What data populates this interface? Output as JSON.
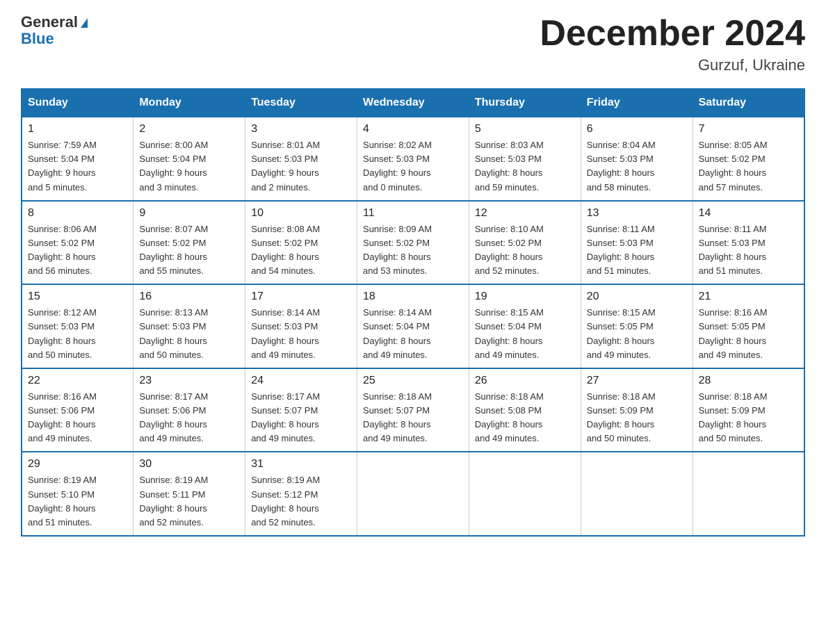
{
  "header": {
    "logo_general": "General",
    "logo_blue": "Blue",
    "month_title": "December 2024",
    "subtitle": "Gurzuf, Ukraine"
  },
  "weekdays": [
    "Sunday",
    "Monday",
    "Tuesday",
    "Wednesday",
    "Thursday",
    "Friday",
    "Saturday"
  ],
  "weeks": [
    [
      {
        "day": "1",
        "info": "Sunrise: 7:59 AM\nSunset: 5:04 PM\nDaylight: 9 hours\nand 5 minutes."
      },
      {
        "day": "2",
        "info": "Sunrise: 8:00 AM\nSunset: 5:04 PM\nDaylight: 9 hours\nand 3 minutes."
      },
      {
        "day": "3",
        "info": "Sunrise: 8:01 AM\nSunset: 5:03 PM\nDaylight: 9 hours\nand 2 minutes."
      },
      {
        "day": "4",
        "info": "Sunrise: 8:02 AM\nSunset: 5:03 PM\nDaylight: 9 hours\nand 0 minutes."
      },
      {
        "day": "5",
        "info": "Sunrise: 8:03 AM\nSunset: 5:03 PM\nDaylight: 8 hours\nand 59 minutes."
      },
      {
        "day": "6",
        "info": "Sunrise: 8:04 AM\nSunset: 5:03 PM\nDaylight: 8 hours\nand 58 minutes."
      },
      {
        "day": "7",
        "info": "Sunrise: 8:05 AM\nSunset: 5:02 PM\nDaylight: 8 hours\nand 57 minutes."
      }
    ],
    [
      {
        "day": "8",
        "info": "Sunrise: 8:06 AM\nSunset: 5:02 PM\nDaylight: 8 hours\nand 56 minutes."
      },
      {
        "day": "9",
        "info": "Sunrise: 8:07 AM\nSunset: 5:02 PM\nDaylight: 8 hours\nand 55 minutes."
      },
      {
        "day": "10",
        "info": "Sunrise: 8:08 AM\nSunset: 5:02 PM\nDaylight: 8 hours\nand 54 minutes."
      },
      {
        "day": "11",
        "info": "Sunrise: 8:09 AM\nSunset: 5:02 PM\nDaylight: 8 hours\nand 53 minutes."
      },
      {
        "day": "12",
        "info": "Sunrise: 8:10 AM\nSunset: 5:02 PM\nDaylight: 8 hours\nand 52 minutes."
      },
      {
        "day": "13",
        "info": "Sunrise: 8:11 AM\nSunset: 5:03 PM\nDaylight: 8 hours\nand 51 minutes."
      },
      {
        "day": "14",
        "info": "Sunrise: 8:11 AM\nSunset: 5:03 PM\nDaylight: 8 hours\nand 51 minutes."
      }
    ],
    [
      {
        "day": "15",
        "info": "Sunrise: 8:12 AM\nSunset: 5:03 PM\nDaylight: 8 hours\nand 50 minutes."
      },
      {
        "day": "16",
        "info": "Sunrise: 8:13 AM\nSunset: 5:03 PM\nDaylight: 8 hours\nand 50 minutes."
      },
      {
        "day": "17",
        "info": "Sunrise: 8:14 AM\nSunset: 5:03 PM\nDaylight: 8 hours\nand 49 minutes."
      },
      {
        "day": "18",
        "info": "Sunrise: 8:14 AM\nSunset: 5:04 PM\nDaylight: 8 hours\nand 49 minutes."
      },
      {
        "day": "19",
        "info": "Sunrise: 8:15 AM\nSunset: 5:04 PM\nDaylight: 8 hours\nand 49 minutes."
      },
      {
        "day": "20",
        "info": "Sunrise: 8:15 AM\nSunset: 5:05 PM\nDaylight: 8 hours\nand 49 minutes."
      },
      {
        "day": "21",
        "info": "Sunrise: 8:16 AM\nSunset: 5:05 PM\nDaylight: 8 hours\nand 49 minutes."
      }
    ],
    [
      {
        "day": "22",
        "info": "Sunrise: 8:16 AM\nSunset: 5:06 PM\nDaylight: 8 hours\nand 49 minutes."
      },
      {
        "day": "23",
        "info": "Sunrise: 8:17 AM\nSunset: 5:06 PM\nDaylight: 8 hours\nand 49 minutes."
      },
      {
        "day": "24",
        "info": "Sunrise: 8:17 AM\nSunset: 5:07 PM\nDaylight: 8 hours\nand 49 minutes."
      },
      {
        "day": "25",
        "info": "Sunrise: 8:18 AM\nSunset: 5:07 PM\nDaylight: 8 hours\nand 49 minutes."
      },
      {
        "day": "26",
        "info": "Sunrise: 8:18 AM\nSunset: 5:08 PM\nDaylight: 8 hours\nand 49 minutes."
      },
      {
        "day": "27",
        "info": "Sunrise: 8:18 AM\nSunset: 5:09 PM\nDaylight: 8 hours\nand 50 minutes."
      },
      {
        "day": "28",
        "info": "Sunrise: 8:18 AM\nSunset: 5:09 PM\nDaylight: 8 hours\nand 50 minutes."
      }
    ],
    [
      {
        "day": "29",
        "info": "Sunrise: 8:19 AM\nSunset: 5:10 PM\nDaylight: 8 hours\nand 51 minutes."
      },
      {
        "day": "30",
        "info": "Sunrise: 8:19 AM\nSunset: 5:11 PM\nDaylight: 8 hours\nand 52 minutes."
      },
      {
        "day": "31",
        "info": "Sunrise: 8:19 AM\nSunset: 5:12 PM\nDaylight: 8 hours\nand 52 minutes."
      },
      {
        "day": "",
        "info": ""
      },
      {
        "day": "",
        "info": ""
      },
      {
        "day": "",
        "info": ""
      },
      {
        "day": "",
        "info": ""
      }
    ]
  ]
}
